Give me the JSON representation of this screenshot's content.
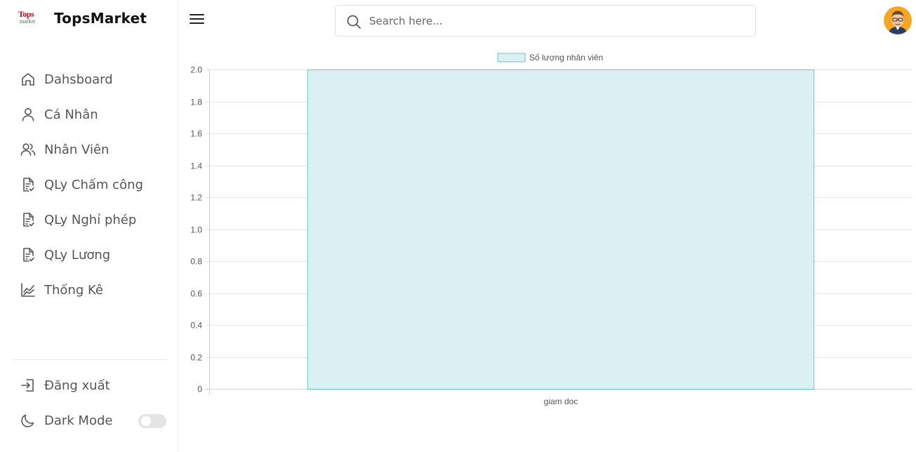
{
  "brand": {
    "logo_line1": "Tops",
    "logo_line2": "market",
    "name": "TopsMarket"
  },
  "sidebar": {
    "items": [
      {
        "label": "Dahsboard",
        "icon": "home-icon"
      },
      {
        "label": "Cá Nhân",
        "icon": "user-icon"
      },
      {
        "label": "Nhân Viên",
        "icon": "users-icon"
      },
      {
        "label": "QLy Chấm công",
        "icon": "document-check-icon"
      },
      {
        "label": "QLy Nghỉ phép",
        "icon": "document-check-icon"
      },
      {
        "label": "QLy Lương",
        "icon": "document-check-icon"
      },
      {
        "label": "Thống Kê",
        "icon": "line-chart-icon"
      }
    ],
    "logout_label": "Đăng xuất",
    "dark_mode_label": "Dark Mode",
    "dark_mode_on": false
  },
  "topbar": {
    "search_placeholder": "Search here..."
  },
  "colors": {
    "bar_fill": "#daf0f2",
    "bar_stroke": "#6cc6c0",
    "grid": "#e6e6e6",
    "text": "#555555"
  },
  "chart_data": {
    "type": "bar",
    "categories": [
      "giam doc"
    ],
    "series": [
      {
        "name": "Số lượng nhân viên",
        "values": [
          2
        ]
      }
    ],
    "ylim": [
      0,
      2.0
    ],
    "yticks": [
      "0",
      "0.2",
      "0.4",
      "0.6",
      "0.8",
      "1.0",
      "1.2",
      "1.4",
      "1.6",
      "1.8",
      "2.0"
    ],
    "legend_position": "top-center",
    "grid": true
  }
}
